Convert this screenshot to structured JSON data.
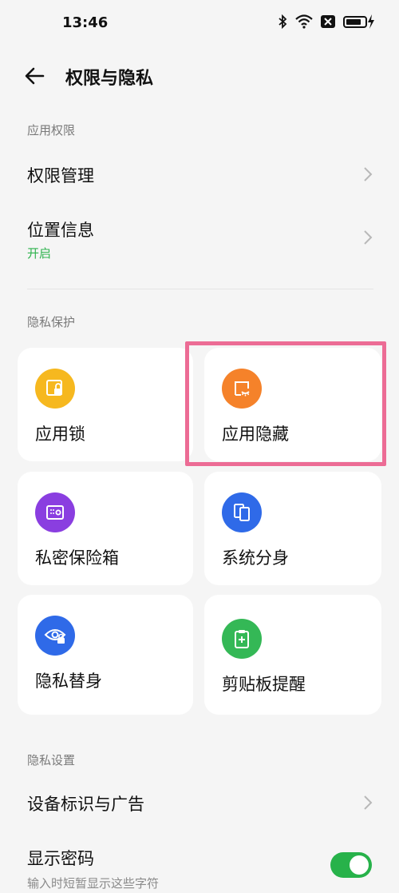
{
  "status": {
    "time": "13:46"
  },
  "header": {
    "title": "权限与隐私"
  },
  "sections": {
    "app_permissions": "应用权限",
    "privacy_protection": "隐私保护",
    "privacy_settings": "隐私设置"
  },
  "rows": {
    "permission_manage": {
      "title": "权限管理"
    },
    "location": {
      "title": "位置信息",
      "subtitle": "开启"
    },
    "device_id_ads": {
      "title": "设备标识与广告"
    },
    "show_password": {
      "title": "显示密码",
      "desc": "输入时短暂显示这些字符",
      "enabled": true
    }
  },
  "cards": {
    "app_lock": {
      "label": "应用锁",
      "icon": "app-lock-icon",
      "color": "#f6b81f"
    },
    "app_hide": {
      "label": "应用隐藏",
      "icon": "app-hide-icon",
      "color": "#f5822a"
    },
    "private_safe": {
      "label": "私密保险箱",
      "icon": "safe-icon",
      "color": "#8a3ee0"
    },
    "system_clone": {
      "label": "系统分身",
      "icon": "clone-icon",
      "color": "#2f6ae8"
    },
    "privacy_substitute": {
      "label": "隐私替身",
      "icon": "eye-lock-icon",
      "color": "#2f6ae8"
    },
    "clipboard_reminder": {
      "label": "剪贴板提醒",
      "icon": "clipboard-icon",
      "color": "#34b856"
    }
  },
  "colors": {
    "accent_green": "#27b24a",
    "highlight": "#ec6c95"
  }
}
